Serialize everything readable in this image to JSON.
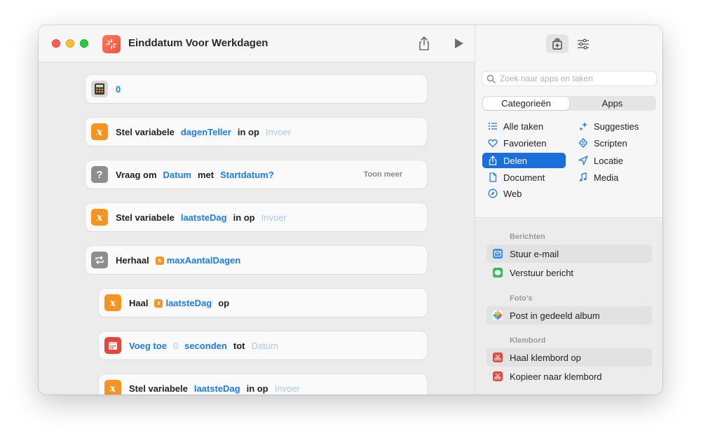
{
  "window": {
    "title": "Einddatum Voor Werkdagen"
  },
  "actions": [
    {
      "kind": "calc",
      "icon": "calculator-icon",
      "parts": [
        {
          "t": "tok",
          "v": "0"
        }
      ]
    },
    {
      "kind": "var",
      "icon": "variable-icon",
      "parts": [
        {
          "t": "w",
          "v": "Stel variabele"
        },
        {
          "t": "tok",
          "v": "dagenTeller"
        },
        {
          "t": "w",
          "v": "in op"
        },
        {
          "t": "ph",
          "v": "Invoer"
        }
      ]
    },
    {
      "kind": "ask",
      "icon": "question-icon",
      "parts": [
        {
          "t": "w",
          "v": "Vraag om"
        },
        {
          "t": "tok",
          "v": "Datum"
        },
        {
          "t": "w",
          "v": "met"
        },
        {
          "t": "tok",
          "v": "Startdatum?"
        }
      ],
      "more": "Toon meer"
    },
    {
      "kind": "var",
      "icon": "variable-icon",
      "parts": [
        {
          "t": "w",
          "v": "Stel variabele"
        },
        {
          "t": "tok",
          "v": "laatsteDag"
        },
        {
          "t": "w",
          "v": "in op"
        },
        {
          "t": "ph",
          "v": "Invoer"
        }
      ]
    },
    {
      "kind": "repeat",
      "icon": "repeat-icon",
      "parts": [
        {
          "t": "w",
          "v": "Herhaal"
        },
        {
          "t": "var",
          "v": "maxAantalDagen"
        }
      ]
    },
    {
      "kind": "var",
      "icon": "variable-icon",
      "parts": [
        {
          "t": "w",
          "v": "Haal"
        },
        {
          "t": "var",
          "v": "laatsteDag"
        },
        {
          "t": "w",
          "v": "op"
        }
      ]
    },
    {
      "kind": "date",
      "icon": "calendar-icon",
      "parts": [
        {
          "t": "tok",
          "v": "Voeg toe"
        },
        {
          "t": "ph",
          "v": "0"
        },
        {
          "t": "tok",
          "v": "seconden"
        },
        {
          "t": "w",
          "v": "tot"
        },
        {
          "t": "ph",
          "v": "Datum"
        }
      ]
    },
    {
      "kind": "var",
      "icon": "variable-icon",
      "parts": [
        {
          "t": "w",
          "v": "Stel variabele"
        },
        {
          "t": "tok",
          "v": "laatsteDag"
        },
        {
          "t": "w",
          "v": "in op"
        },
        {
          "t": "ph",
          "v": "Invoer"
        }
      ]
    }
  ],
  "sidebar": {
    "search_placeholder": "Zoek naar apps en taken",
    "segments": [
      "Categorieën",
      "Apps"
    ],
    "categories_left": [
      "Alle taken",
      "Favorieten",
      "Delen",
      "Document",
      "Web"
    ],
    "categories_right": [
      "Suggesties",
      "Scripten",
      "Locatie",
      "Media"
    ],
    "sections": [
      {
        "title": "Berichten",
        "items": [
          "Stuur e-mail",
          "Verstuur bericht"
        ]
      },
      {
        "title": "Foto's",
        "items": [
          "Post in gedeeld album"
        ]
      },
      {
        "title": "Klembord",
        "items": [
          "Haal klembord op",
          "Kopieer naar klembord"
        ]
      }
    ]
  },
  "colors": {
    "accent": "#1a7cf2",
    "orange": "#f7931e",
    "selection": "#1a6fdc"
  }
}
